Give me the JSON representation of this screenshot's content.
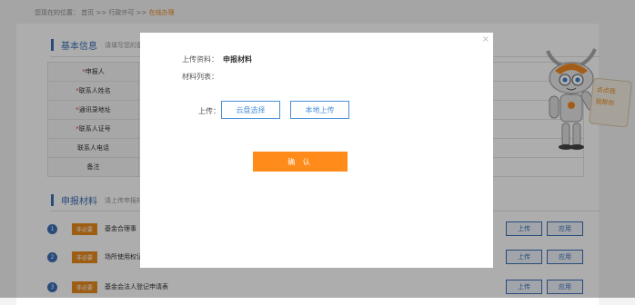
{
  "breadcrumb": {
    "prefix": "您现在的位置：",
    "home": "首页",
    "sep1": ">>",
    "section": "行政许可",
    "sep2": ">>",
    "current": "在线办理"
  },
  "basic": {
    "title": "基本信息",
    "hint": "请填写您的基",
    "rows": [
      {
        "label": "申报人",
        "required": true
      },
      {
        "label": "联系人姓名",
        "required": true
      },
      {
        "label": "通讯录地址",
        "required": true
      },
      {
        "label": "联系人证号",
        "required": true
      },
      {
        "label": "联系人电话",
        "required": false
      },
      {
        "label": "备注",
        "required": false
      }
    ]
  },
  "materials": {
    "title": "申报材料",
    "hint": "请上传申报材",
    "items": [
      {
        "num": "1",
        "tag": "非必要",
        "name": "基金合理事",
        "upload": "上传",
        "apply": "应用"
      },
      {
        "num": "2",
        "tag": "非必要",
        "name": "场所使用权证",
        "upload": "上传",
        "apply": "应用"
      },
      {
        "num": "3",
        "tag": "非必要",
        "name": "基金会法人登记申请表",
        "upload": "上传",
        "apply": "应用"
      }
    ]
  },
  "mascot": {
    "line1": "点点我",
    "line2": "我帮你"
  },
  "modal": {
    "material_label": "上传资料：",
    "material_value": "申报材料",
    "list_label": "材料列表：",
    "upload_label": "上传：",
    "cloud_button": "云盘选择",
    "local_button": "本地上传",
    "confirm_button": "确 认",
    "close": "×"
  },
  "colors": {
    "accent": "#3b6fb6",
    "orange": "#ff8c1a",
    "link": "#4a90d9"
  }
}
